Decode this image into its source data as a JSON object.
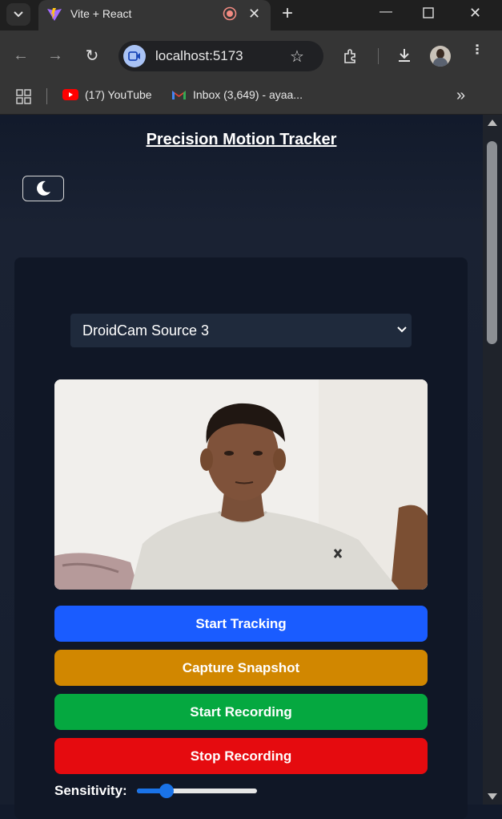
{
  "browser": {
    "tab_title": "Vite + React",
    "url": "localhost:5173",
    "bookmarks": [
      {
        "label": "(17) YouTube",
        "icon": "youtube-icon"
      },
      {
        "label": "Inbox (3,649) - ayaa...",
        "icon": "gmail-icon"
      }
    ]
  },
  "app": {
    "title": "Precision Motion Tracker",
    "theme_icon": "moon-icon",
    "camera_select": {
      "selected": "DroidCam Source 3"
    },
    "buttons": {
      "start_tracking": "Start Tracking",
      "capture_snapshot": "Capture Snapshot",
      "start_recording": "Start Recording",
      "stop_recording": "Stop Recording"
    },
    "sensitivity": {
      "label": "Sensitivity:",
      "value_fraction": 0.25
    }
  },
  "colors": {
    "start_tracking": "#1a5cff",
    "capture_snapshot": "#d18700",
    "start_recording": "#05a840",
    "stop_recording": "#e50b0f",
    "page_bg": "#121a2b",
    "panel_bg": "#101726"
  }
}
